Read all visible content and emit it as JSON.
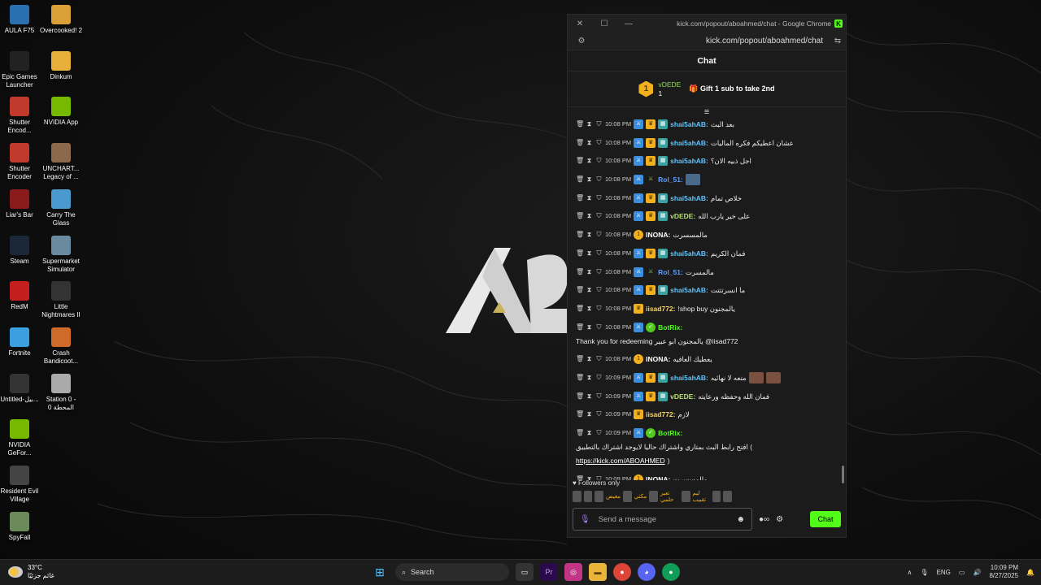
{
  "desktop": {
    "icons_col1": [
      {
        "label": "AULA F75",
        "icon": "aula-icon",
        "color": "#2a6fb0"
      },
      {
        "label": "Epic Games Launcher",
        "icon": "epic-games-icon",
        "color": "#222222"
      },
      {
        "label": "Shutter Encod...",
        "icon": "shutter-encoder-icon",
        "color": "#c0392b"
      },
      {
        "label": "Shutter Encoder",
        "icon": "shutter-encoder-icon",
        "color": "#c0392b"
      },
      {
        "label": "Liar's Bar",
        "icon": "liars-bar-icon",
        "color": "#8b1a1a"
      },
      {
        "label": "Steam",
        "icon": "steam-icon",
        "color": "#1b2838"
      },
      {
        "label": "RedM",
        "icon": "redm-icon",
        "color": "#c41e1e"
      },
      {
        "label": "Fortnite",
        "icon": "fortnite-icon",
        "color": "#3aa0e0"
      },
      {
        "label": "Untitled-بيل...",
        "icon": "file-icon",
        "color": "#333333"
      },
      {
        "label": "NVIDIA GeFor...",
        "icon": "nvidia-icon",
        "color": "#76b900"
      },
      {
        "label": "Resident Evil Village",
        "icon": "resident-evil-icon",
        "color": "#444444"
      },
      {
        "label": "SpyFall",
        "icon": "spyfall-icon",
        "color": "#6a8a5a"
      }
    ],
    "icons_col2": [
      {
        "label": "Overcooked! 2",
        "icon": "overcooked-icon",
        "color": "#d9a03a"
      },
      {
        "label": "Dinkum",
        "icon": "dinkum-icon",
        "color": "#e8b03a"
      },
      {
        "label": "NVIDIA App",
        "icon": "nvidia-icon",
        "color": "#76b900"
      },
      {
        "label": "UNCHART... Legacy of ...",
        "icon": "uncharted-icon",
        "color": "#8a6a4a"
      },
      {
        "label": "Carry The Glass",
        "icon": "carry-glass-icon",
        "color": "#4a9ad0"
      },
      {
        "label": "Supermarket Simulator",
        "icon": "supermarket-icon",
        "color": "#6a8aa0"
      },
      {
        "label": "Little Nightmares II",
        "icon": "little-nightmares-icon",
        "color": "#333333"
      },
      {
        "label": "Crash Bandicoot...",
        "icon": "crash-icon",
        "color": "#d06a2a"
      },
      {
        "label": "Station 0 - المحطة 0",
        "icon": "station-icon",
        "color": "#aaaaaa"
      }
    ]
  },
  "browser": {
    "window_title": "kick.com/popout/aboahmed/chat - Google Chrome",
    "url": "kick.com/popout/aboahmed/chat",
    "brand_letter": "K"
  },
  "chat": {
    "header": "Chat",
    "gift": {
      "rank": "1",
      "user": "vDEDE",
      "count": "1",
      "label": "Gift 1 sub to take 2nd"
    },
    "messages": [
      {
        "time": "10:08 PM",
        "user": "shai5ahAB:",
        "user_color": "#5fc4ff",
        "badges": [
          "blue",
          "gold",
          "green"
        ],
        "text": "بعد البث"
      },
      {
        "time": "10:08 PM",
        "user": "shai5ahAB:",
        "user_color": "#5fc4ff",
        "badges": [
          "blue",
          "gold",
          "green"
        ],
        "text": "عشان اعطيكم فكره الماليات"
      },
      {
        "time": "10:08 PM",
        "user": "shai5ahAB:",
        "user_color": "#5fc4ff",
        "badges": [
          "blue",
          "gold",
          "green"
        ],
        "text": "اجل ذبيه الان؟"
      },
      {
        "time": "10:08 PM",
        "user": "Rol_51:",
        "user_color": "#5f9fff",
        "badges": [
          "blue",
          "rank"
        ],
        "text": "",
        "emote": true
      },
      {
        "time": "10:08 PM",
        "user": "shai5ahAB:",
        "user_color": "#5fc4ff",
        "badges": [
          "blue",
          "gold",
          "green"
        ],
        "text": "خلاص تمام"
      },
      {
        "time": "10:08 PM",
        "user": "vDEDE:",
        "user_color": "#b4e06a",
        "badges": [
          "blue",
          "gold",
          "green"
        ],
        "text": "على خير يارب الله"
      },
      {
        "time": "10:08 PM",
        "user": "INONA:",
        "user_color": "#ffffff",
        "badges": [
          "circle"
        ],
        "text": "مالمسسرت"
      },
      {
        "time": "10:08 PM",
        "user": "shai5ahAB:",
        "user_color": "#5fc4ff",
        "badges": [
          "blue",
          "gold",
          "green"
        ],
        "text": "فمان الكريم"
      },
      {
        "time": "10:08 PM",
        "user": "Rol_51:",
        "user_color": "#5f9fff",
        "badges": [
          "blue",
          "rank"
        ],
        "text": "مالمسرت"
      },
      {
        "time": "10:08 PM",
        "user": "shai5ahAB:",
        "user_color": "#5fc4ff",
        "badges": [
          "blue",
          "gold",
          "green"
        ],
        "text": "ما انسرتتتت"
      },
      {
        "time": "10:08 PM",
        "user": "iisad772:",
        "user_color": "#f2d36a",
        "badges": [
          "gold"
        ],
        "text": "!shop buy يالمجنون"
      },
      {
        "time": "10:08 PM",
        "user": "BotRix:",
        "user_color": "#53fc18",
        "badges": [
          "blue",
          "check"
        ],
        "text": "Thank you for redeeming يالمجنون ابو عبير @iisad772"
      },
      {
        "time": "10:08 PM",
        "user": "INONA:",
        "user_color": "#ffffff",
        "badges": [
          "circle"
        ],
        "text": "يعطيك العافيه"
      },
      {
        "time": "10:09 PM",
        "user": "shai5ahAB:",
        "user_color": "#5fc4ff",
        "badges": [
          "blue",
          "gold",
          "green"
        ],
        "text": "متعه لا نهائيه",
        "emote2": true
      },
      {
        "time": "10:09 PM",
        "user": "vDEDE:",
        "user_color": "#b4e06a",
        "badges": [
          "blue",
          "gold",
          "green"
        ],
        "text": "فمان الله وحفظه ورعايته"
      },
      {
        "time": "10:09 PM",
        "user": "iisad772:",
        "user_color": "#f2d36a",
        "badges": [
          "gold"
        ],
        "text": "لازم"
      },
      {
        "time": "10:09 PM",
        "user": "BotRix:",
        "user_color": "#53fc18",
        "badges": [
          "blue",
          "check"
        ],
        "text": "افتح رابط البث بمتاري واشتراك حاليا لايوجد اشتراك بالتطبيق (",
        "link": "https://kick.com/ABOAHMED",
        "text_after": ")"
      },
      {
        "time": "10:09 PM",
        "user": "INONA:",
        "user_color": "#ffffff",
        "badges": [
          "circle"
        ],
        "text": "مالمسسرت"
      }
    ],
    "followers_only": "Followers only",
    "emote_strip_text": [
      "مغيض",
      "مكثي",
      "تعير حلمي",
      "ليم تقبيب"
    ],
    "input_placeholder": "Send a message",
    "send_label": "Chat"
  },
  "taskbar": {
    "weather_temp": "33°C",
    "weather_desc": "غائم جزئيًا",
    "search_label": "Search",
    "lang": "ENG",
    "time": "10:09 PM",
    "date": "8/27/2025"
  }
}
